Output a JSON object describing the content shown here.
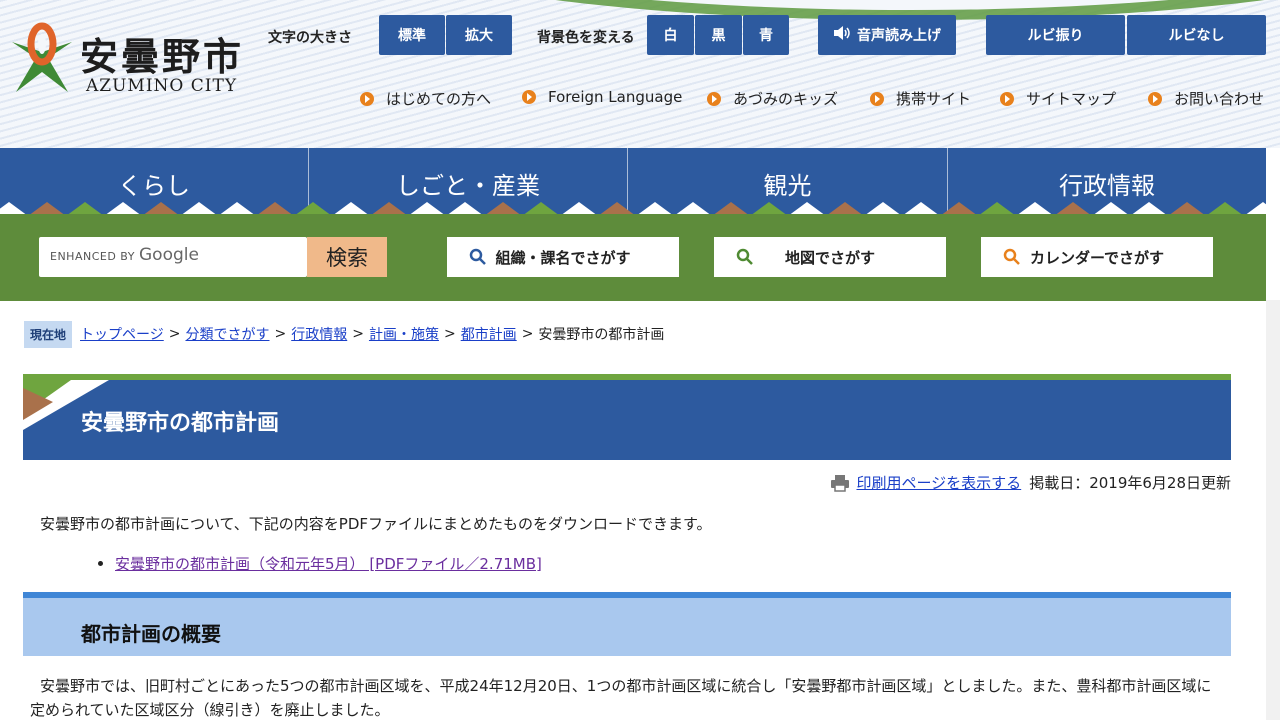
{
  "logo": {
    "name_jp": "安曇野市",
    "name_en": "AZUMINO CITY"
  },
  "toolbar": {
    "font_size_label": "文字の大きさ",
    "font_standard": "標準",
    "font_large": "拡大",
    "bg_label": "背景色を変える",
    "bg_white": "白",
    "bg_black": "黒",
    "bg_blue": "青",
    "read_aloud": "音声読み上げ",
    "ruby_on": "ルビ振り",
    "ruby_off": "ルビなし"
  },
  "subnav": [
    {
      "label": "はじめての方へ"
    },
    {
      "label": "Foreign Language"
    },
    {
      "label": "あづみのキッズ"
    },
    {
      "label": "携帯サイト"
    },
    {
      "label": "サイトマップ"
    },
    {
      "label": "お問い合わせ"
    }
  ],
  "global_nav": [
    {
      "label": "くらし"
    },
    {
      "label": "しごと・産業"
    },
    {
      "label": "観光"
    },
    {
      "label": "行政情報"
    }
  ],
  "search": {
    "enhanced_by": "ENHANCED BY",
    "google": "Google",
    "button": "検索",
    "org_search": "組織・課名でさがす",
    "map_search": "地図でさがす",
    "calendar_search": "カレンダーでさがす"
  },
  "breadcrumb": {
    "badge": "現在地",
    "links": [
      "トップページ",
      "分類でさがす",
      "行政情報",
      "計画・施策",
      "都市計画"
    ],
    "sep": ">",
    "current": "安曇野市の都市計画"
  },
  "page": {
    "title": "安曇野市の都市計画",
    "print_link": "印刷用ページを表示する",
    "posted": "掲載日：2019年6月28日更新",
    "intro": "安曇野市の都市計画について、下記の内容をPDFファイルにまとめたものをダウンロードできます。",
    "pdf_link": "安曇野市の都市計画（令和元年5月） [PDFファイル／2.71MB]",
    "section_heading": "都市計画の概要",
    "section_body": "安曇野市では、旧町村ごとにあった5つの都市計画区域を、平成24年12月20日、1つの都市計画区域に統合し「安曇野都市計画区域」としました。また、豊科都市計画区域に定められていた区域区分（線引き）を廃止しました。"
  },
  "colors": {
    "nav_blue": "#2d5a9f",
    "nav_green": "#5e8c3b",
    "accent_orange": "#e8811c",
    "search_button": "#f0b98a",
    "section_heading_bg": "#a9c8ee"
  }
}
